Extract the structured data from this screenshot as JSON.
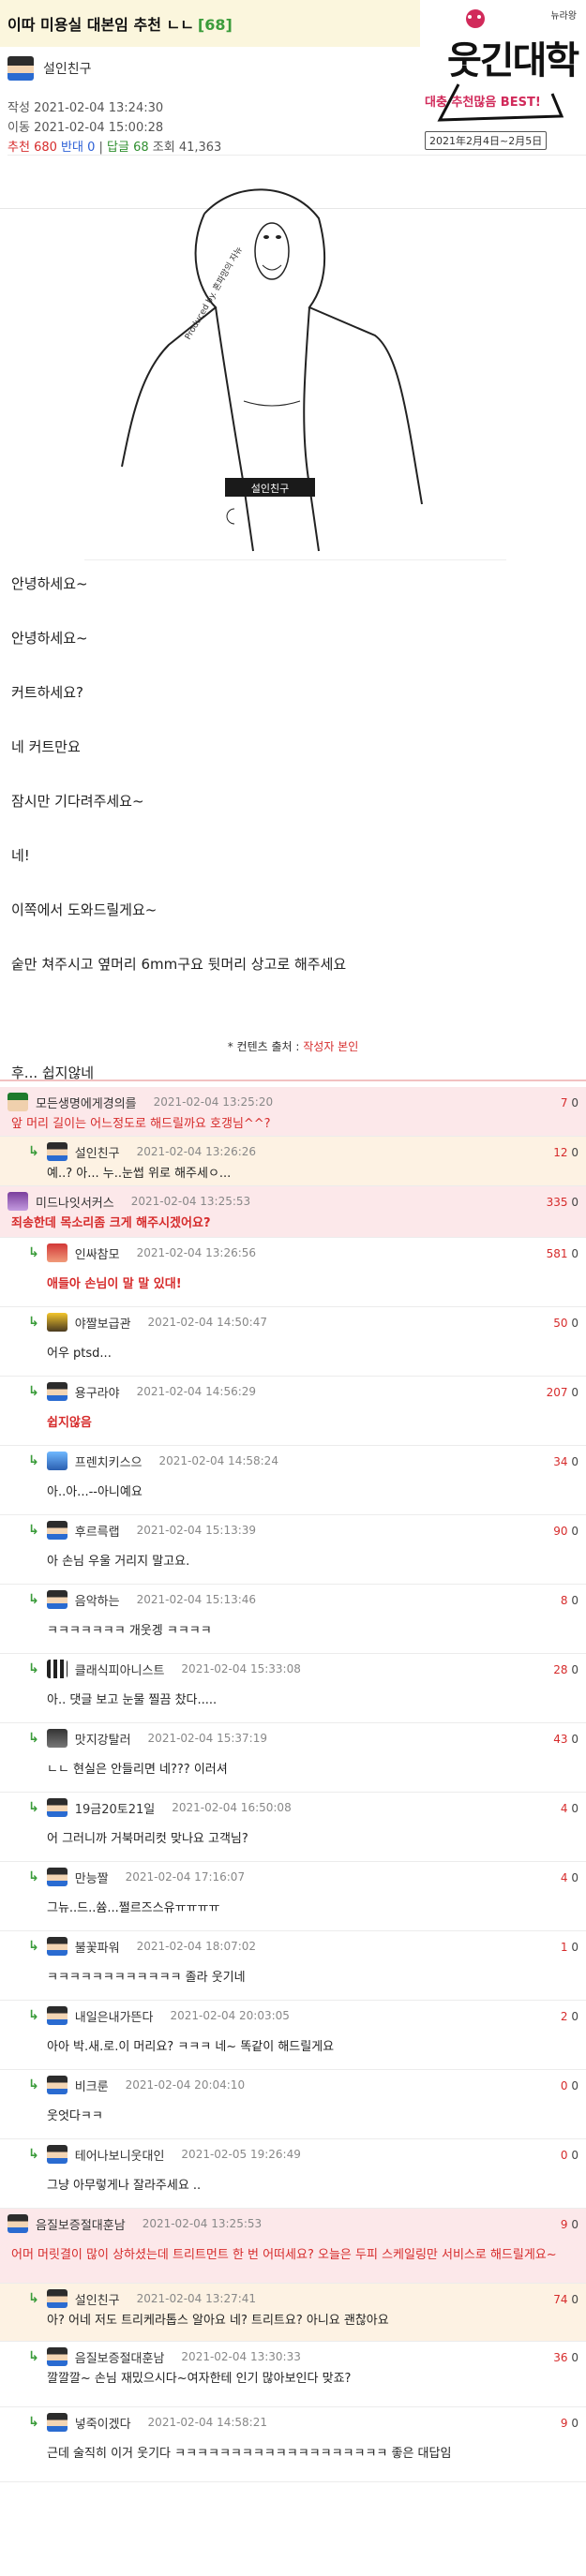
{
  "post": {
    "title": "이따 미용실 대본임 추천 ㄴㄴ",
    "comment_count": "[68]",
    "author": "설인친구",
    "written_label": "작성",
    "written_date": "2021-02-04 13:24:30",
    "moved_label": "이동",
    "moved_date": "2021-02-04 15:00:28",
    "recommend_label": "추천",
    "recommend": "680",
    "oppose_label": "반대",
    "oppose": "0",
    "replies_label": "답글",
    "replies": "68",
    "views_label": "조회",
    "views": "41,363"
  },
  "logo": {
    "main": "웃긴대학",
    "sub": "대충 추천많음 BEST!",
    "small": "뉴라왕",
    "date": "2021年2月4日~2月5日"
  },
  "figure": {
    "caption": "설인친구",
    "credit": "Produced by. 혼파망의 자뉴"
  },
  "body": [
    "안녕하세요~",
    "안녕하세요~",
    "커트하세요?",
    "네 커트만요",
    "잠시만 기다려주세요~",
    "네!",
    "이쪽에서 도와드릴게요~",
    "숱만 쳐주시고 옆머리 6mm구요 뒷머리 상고로 해주세요",
    "",
    "후... 쉽지않네"
  ],
  "source": {
    "label": "* 컨텐츠 출처 :",
    "link": "작성자 본인"
  },
  "comments": [
    {
      "nick": "모든생명에게경의를",
      "date": "2021-02-04 13:25:20",
      "up": "7",
      "down": "0",
      "text": "앞 머리 길이는 어느정도로 해드릴까요 호갱님^^?",
      "reply": false,
      "style": "pink top",
      "avatar": "green",
      "h": 53,
      "bold": false
    },
    {
      "nick": "설인친구",
      "date": "2021-02-04 13:26:26",
      "up": "12",
      "down": "0",
      "text": "예..? 아... 누..눈썹 위로 해주세ㅇ...",
      "reply": true,
      "style": "orange",
      "avatar": "default",
      "h": 53,
      "bold": false
    },
    {
      "nick": "미드나잇서커스",
      "date": "2021-02-04 13:25:53",
      "up": "335",
      "down": "0",
      "text": "죄송한데 목소리좀 크게 해주시겠어요?",
      "reply": false,
      "style": "pink top",
      "avatar": "purple",
      "h": 55,
      "bold": true
    },
    {
      "nick": "인싸참모",
      "date": "2021-02-04 13:26:56",
      "up": "581",
      "down": "0",
      "text": "애들아 손님이 말 말 있대!",
      "reply": true,
      "style": "",
      "avatar": "red",
      "h": 74,
      "bold": true
    },
    {
      "nick": "야짤보급관",
      "date": "2021-02-04 14:50:47",
      "up": "50",
      "down": "0",
      "text": "어우 ptsd...",
      "reply": true,
      "style": "",
      "avatar": "yellow",
      "h": 74,
      "bold": false
    },
    {
      "nick": "용구라야",
      "date": "2021-02-04 14:56:29",
      "up": "207",
      "down": "0",
      "text": "쉽지않음",
      "reply": true,
      "style": "",
      "avatar": "default",
      "h": 74,
      "bold": true
    },
    {
      "nick": "프렌치키스으",
      "date": "2021-02-04 14:58:24",
      "up": "34",
      "down": "0",
      "text": "아..아...--아니예요",
      "reply": true,
      "style": "",
      "avatar": "sky",
      "h": 74,
      "bold": false
    },
    {
      "nick": "후르륵랩",
      "date": "2021-02-04 15:13:39",
      "up": "90",
      "down": "0",
      "text": "아 손님 우울 거리지 말고요.",
      "reply": true,
      "style": "",
      "avatar": "default",
      "h": 74,
      "bold": false
    },
    {
      "nick": "음악하는",
      "date": "2021-02-04 15:13:46",
      "up": "8",
      "down": "0",
      "text": "ㅋㅋㅋㅋㅋㅋㅋ 개웃겡 ㅋㅋㅋㅋ",
      "reply": true,
      "style": "",
      "avatar": "default",
      "h": 74,
      "bold": false
    },
    {
      "nick": "클래식피아니스트",
      "date": "2021-02-04 15:33:08",
      "up": "28",
      "down": "0",
      "text": "아.. 댓글 보고 눈물 찔끔 찼다.....",
      "reply": true,
      "style": "",
      "avatar": "piano",
      "h": 74,
      "bold": false
    },
    {
      "nick": "맛지강탈러",
      "date": "2021-02-04 15:37:19",
      "up": "43",
      "down": "0",
      "text": "ㄴㄴ 현실은 안들리면 네??? 이러셔",
      "reply": true,
      "style": "",
      "avatar": "dark",
      "h": 74,
      "bold": false
    },
    {
      "nick": "19금20토21일",
      "date": "2021-02-04 16:50:08",
      "up": "4",
      "down": "0",
      "text": "어 그러니까 거북머리컷 맞나요 고객님?",
      "reply": true,
      "style": "",
      "avatar": "default",
      "h": 74,
      "bold": false
    },
    {
      "nick": "만능짤",
      "date": "2021-02-04 17:16:07",
      "up": "4",
      "down": "0",
      "text": "그뉴..드..쓤...쩔르즈스유ㅠㅠㅠㅠ",
      "reply": true,
      "style": "",
      "avatar": "default",
      "h": 74,
      "bold": false
    },
    {
      "nick": "불꽃파워",
      "date": "2021-02-04 18:07:02",
      "up": "1",
      "down": "0",
      "text": "ㅋㅋㅋㅋㅋㅋㅋㅋㅋㅋㅋㅋ 졸라 웃기네",
      "reply": true,
      "style": "",
      "avatar": "default",
      "h": 74,
      "bold": false
    },
    {
      "nick": "내일은내가뜬다",
      "date": "2021-02-04 20:03:05",
      "up": "2",
      "down": "0",
      "text": "아아 박.새.로.이 머리요? ㅋㅋㅋ 네~ 똑같이 해드릴게요",
      "reply": true,
      "style": "",
      "avatar": "default",
      "h": 74,
      "bold": false
    },
    {
      "nick": "비크룬",
      "date": "2021-02-04 20:04:10",
      "up": "0",
      "down": "0",
      "text": "웃엇다ㅋㅋ",
      "reply": true,
      "style": "",
      "avatar": "default",
      "h": 74,
      "bold": false
    },
    {
      "nick": "테어나보니웃대인",
      "date": "2021-02-05 19:26:49",
      "up": "0",
      "down": "0",
      "text": "그냥 아무렇게나 잘라주세요 ..",
      "reply": true,
      "style": "",
      "avatar": "default",
      "h": 74,
      "bold": false
    },
    {
      "nick": "음질보증절대훈남",
      "date": "2021-02-04 13:25:53",
      "up": "9",
      "down": "0",
      "text": "어머 머릿결이 많이 상하셨는데 트리트먼트 한 번 어떠세요? 오늘은 두피 스케일링만 서비스로 해드릴게요~",
      "reply": false,
      "style": "pink top",
      "avatar": "default",
      "h": 80,
      "bold": false
    },
    {
      "nick": "설인친구",
      "date": "2021-02-04 13:27:41",
      "up": "74",
      "down": "0",
      "text": "아? 어네 저도 트리케라톱스 알아요 네? 트리트요? 아니요 괜찮아요",
      "reply": true,
      "style": "orange",
      "avatar": "default",
      "h": 62,
      "bold": false
    },
    {
      "nick": "음질보증절대훈남",
      "date": "2021-02-04 13:30:33",
      "up": "36",
      "down": "0",
      "text": "깔깔깔~ 손님 재밌으시다~여자한테 인기 많아보인다 맞죠?",
      "reply": true,
      "style": "",
      "avatar": "default",
      "h": 70,
      "bold": false
    },
    {
      "nick": "넣죽이겠다",
      "date": "2021-02-04 14:58:21",
      "up": "9",
      "down": "0",
      "text": "근데 술직히 이거 웃기다 ㅋㅋㅋㅋㅋㅋㅋㅋㅋㅋㅋㅋㅋㅋㅋㅋㅋㅋㅋ 좋은 대답임",
      "reply": true,
      "style": "",
      "avatar": "default",
      "h": 80,
      "bold": false
    }
  ]
}
